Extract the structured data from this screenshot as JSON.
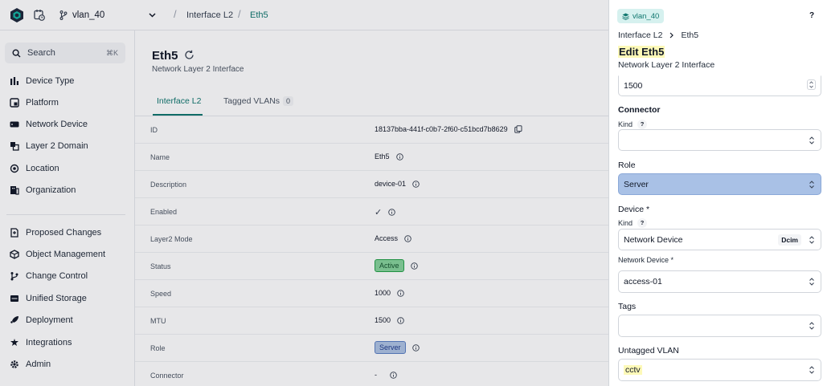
{
  "topbar": {
    "branch": "vlan_40",
    "breadcrumbs": [
      "Interface L2",
      "Eth5"
    ]
  },
  "sidebar": {
    "search_label": "Search",
    "search_shortcut": "⌘K",
    "items": [
      {
        "label": "Device Type",
        "icon": "bar-chart-icon"
      },
      {
        "label": "Platform",
        "icon": "platform-icon"
      },
      {
        "label": "Network Device",
        "icon": "server-icon"
      },
      {
        "label": "Layer 2 Domain",
        "icon": "layers-icon"
      },
      {
        "label": "Location",
        "icon": "location-pin-icon"
      },
      {
        "label": "Organization",
        "icon": "building-icon"
      }
    ],
    "items2": [
      {
        "label": "Proposed Changes",
        "icon": "proposed-changes-icon"
      },
      {
        "label": "Object Management",
        "icon": "cube-icon"
      },
      {
        "label": "Change Control",
        "icon": "git-branch-icon"
      },
      {
        "label": "Unified Storage",
        "icon": "storage-icon"
      },
      {
        "label": "Deployment",
        "icon": "rocket-icon"
      },
      {
        "label": "Integrations",
        "icon": "integrations-icon"
      },
      {
        "label": "Admin",
        "icon": "gear-icon"
      }
    ]
  },
  "main": {
    "title": "Eth5",
    "subtitle": "Network Layer 2 Interface",
    "tabs": [
      {
        "label": "Interface L2"
      },
      {
        "label": "Tagged VLANs",
        "badge": "0"
      }
    ],
    "rows": [
      {
        "key": "ID",
        "value": "18137bba-441f-c0b7-2f60-c51bcd7b8629"
      },
      {
        "key": "Name",
        "value": "Eth5"
      },
      {
        "key": "Description",
        "value": "device-01"
      },
      {
        "key": "Enabled",
        "value": "✓"
      },
      {
        "key": "Layer2 Mode",
        "value": "Access"
      },
      {
        "key": "Status",
        "value": "Active"
      },
      {
        "key": "Speed",
        "value": "1000"
      },
      {
        "key": "MTU",
        "value": "1500"
      },
      {
        "key": "Role",
        "value": "Server"
      },
      {
        "key": "Connector",
        "value": "-"
      }
    ]
  },
  "drawer": {
    "branch": "vlan_40",
    "help": "?",
    "breadcrumb": [
      "Interface L2",
      "Eth5"
    ],
    "title": "Edit Eth5",
    "subtitle": "Network Layer 2 Interface",
    "mtu_value": "1500",
    "connector_label": "Connector",
    "kind_label": "Kind",
    "role_label": "Role",
    "role_value": "Server",
    "device_label": "Device *",
    "device_kind_label": "Kind",
    "device_kind_value": "Network Device",
    "device_kind_badge": "Dcim",
    "network_device_label": "Network Device *",
    "network_device_value": "access-01",
    "tags_label": "Tags",
    "untagged_vlan_label": "Untagged VLAN",
    "untagged_vlan_value": "cctv"
  },
  "colors": {
    "accent": "#0f766e",
    "status_active": "#86d39b",
    "role_server": "#aec3e4",
    "highlight": "#fdf9b8"
  }
}
